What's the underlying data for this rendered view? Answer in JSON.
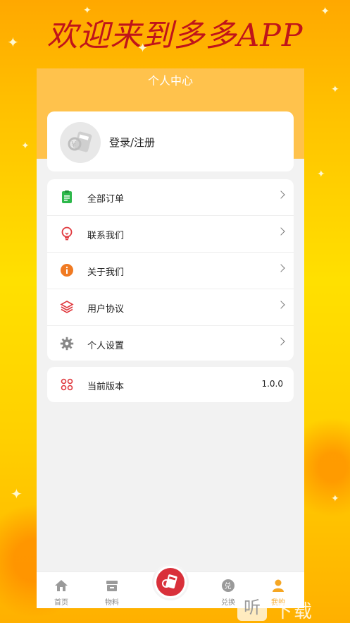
{
  "banner": {
    "text": "欢迎来到多多APP"
  },
  "header": {
    "title": "个人中心"
  },
  "login": {
    "label": "登录/注册",
    "avatar_icon": "calculator-logo-icon"
  },
  "menu": {
    "items": [
      {
        "label": "全部订单",
        "icon": "clipboard-icon",
        "color": "#2db84b"
      },
      {
        "label": "联系我们",
        "icon": "lightbulb-icon",
        "color": "#e0393e"
      },
      {
        "label": "关于我们",
        "icon": "info-icon",
        "color": "#f07a22"
      },
      {
        "label": "用户协议",
        "icon": "layers-icon",
        "color": "#e0393e"
      },
      {
        "label": "个人设置",
        "icon": "gear-icon",
        "color": "#888888"
      }
    ]
  },
  "version": {
    "label": "当前版本",
    "value": "1.0.0",
    "icon": "apps-grid-icon",
    "color": "#e0393e"
  },
  "tabbar": {
    "tabs": [
      {
        "label": "首页",
        "icon": "home-icon"
      },
      {
        "label": "物料",
        "icon": "store-icon"
      },
      {
        "label": "",
        "icon": "calculator-logo-icon"
      },
      {
        "label": "兑换",
        "icon": "exchange-icon"
      },
      {
        "label": "我的",
        "icon": "person-icon"
      }
    ],
    "active_color": "#f5a623"
  },
  "watermark": {
    "text": "下载",
    "box_char": "听"
  },
  "accent_color": "#ffc24c"
}
